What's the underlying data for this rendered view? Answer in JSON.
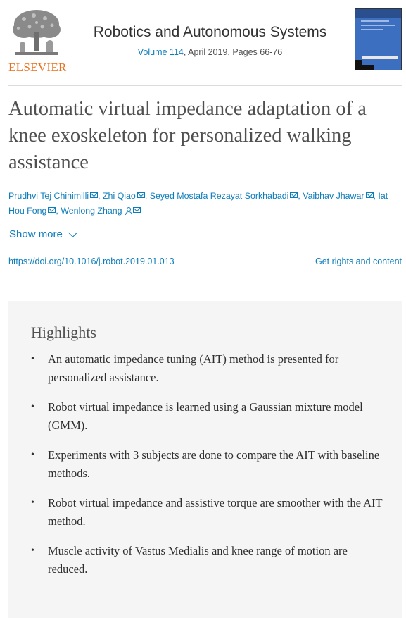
{
  "header": {
    "publisher": "ELSEVIER",
    "journal_title": "Robotics and Autonomous Systems",
    "volume_link": "Volume 114",
    "issue_details": ", April 2019, Pages 66-76"
  },
  "article": {
    "title": "Automatic virtual impedance adaptation of a knee exoskeleton for personalized walking assistance",
    "authors": [
      {
        "name": "Prudhvi Tej Chinimilli",
        "sep": ", "
      },
      {
        "name": "Zhi Qiao",
        "sep": ", "
      },
      {
        "name": "Seyed Mostafa Rezayat Sorkhabadi",
        "sep": ", "
      },
      {
        "name": "Vaibhav Jhawar",
        "sep": ", "
      },
      {
        "name": "Iat Hou Fong",
        "sep": ", "
      },
      {
        "name": "Wenlong Zhang",
        "sep": ""
      }
    ],
    "show_more": "Show more",
    "doi": "https://doi.org/10.1016/j.robot.2019.01.013",
    "rights": "Get rights and content"
  },
  "highlights": {
    "title": "Highlights",
    "items": [
      "An automatic impedance tuning (AIT) method is presented for personalized assistance.",
      "Robot virtual impedance is learned using a Gaussian mixture model (GMM).",
      "Experiments with 3 subjects are done to compare the AIT with baseline methods.",
      "Robot virtual impedance and assistive torque are smoother with the AIT method.",
      "Muscle activity of Vastus Medialis and knee range of motion are reduced."
    ]
  },
  "colors": {
    "link": "#0c7dbb",
    "brand": "#e9711c",
    "highlight_bg": "#f5f5f5"
  }
}
